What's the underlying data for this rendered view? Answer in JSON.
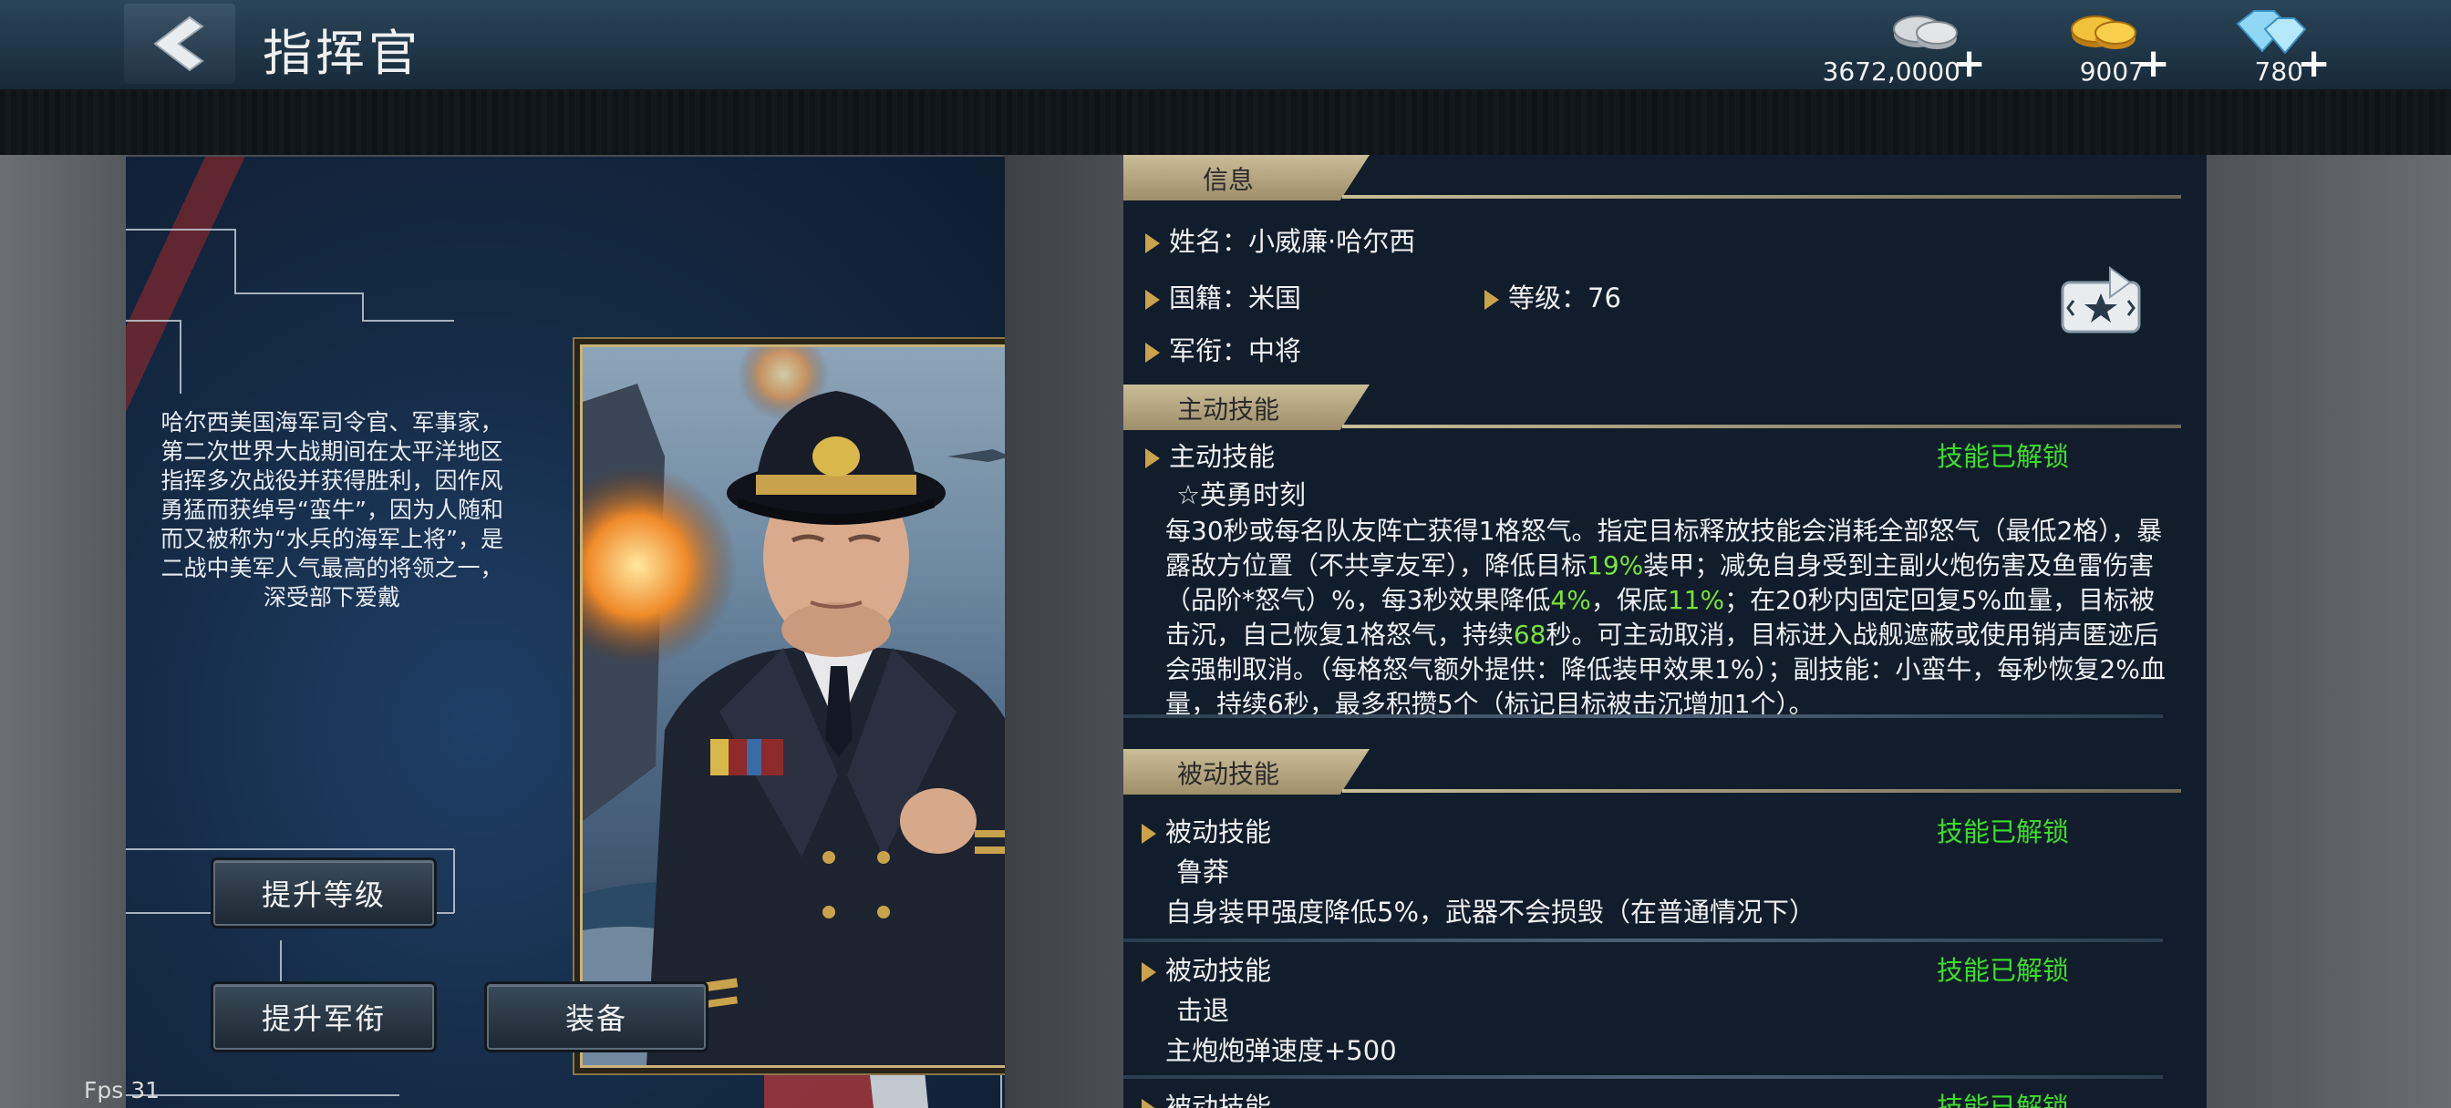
{
  "header": {
    "title": "指挥官",
    "resources": [
      {
        "name": "silver",
        "value": "3672,0000",
        "icon": "silver-coins-icon"
      },
      {
        "name": "gold",
        "value": "9007",
        "icon": "gold-coins-icon"
      },
      {
        "name": "diamond",
        "value": "780",
        "icon": "diamond-icon"
      }
    ]
  },
  "left": {
    "bio": "哈尔西美国海军司令官、军事家，第二次世界大战期间在太平洋地区指挥多次战役并获得胜利，因作风勇猛而获绰号“蛮牛”，因为人随和而又被称为“水兵的海军上将”，是二战中美军人气最高的将领之一，深受部下爱戴",
    "buttons": {
      "upgrade_level": "提升等级",
      "upgrade_rank": "提升军衔",
      "equip": "装备"
    },
    "fps": "Fps 31"
  },
  "info": {
    "section_title": "信息",
    "name_label": "姓名：",
    "name_value": "小威廉·哈尔西",
    "nation_label": "国籍：",
    "nation_value": "米国",
    "level_label": "等级：",
    "level_value": "76",
    "rank_label": "军衔：",
    "rank_value": "中将"
  },
  "active_skill": {
    "section_title": "主动技能",
    "label": "主动技能",
    "status": "技能已解锁",
    "name": "☆英勇时刻",
    "desc_parts": [
      {
        "t": "每30秒或每名队友阵亡获得1格怒气。指定目标释放技能会消耗全部怒气（最低2格），暴露敌方位置（不共享友军），降低目标"
      },
      {
        "t": "19%",
        "hl": true
      },
      {
        "t": "装甲；减免自身受到主副火炮伤害及鱼雷伤害（品阶*怒气）%，每3秒效果降低"
      },
      {
        "t": "4%",
        "hl": true
      },
      {
        "t": "，保底"
      },
      {
        "t": "11%",
        "hl": true
      },
      {
        "t": "；在20秒内固定回复5%血量，目标被击沉，自己恢复1格怒气，持续"
      },
      {
        "t": "68",
        "hl": true
      },
      {
        "t": "秒。可主动取消，目标进入战舰遮蔽或使用销声匿迹后会强制取消。（每格怒气额外提供：降低装甲效果1%）；副技能：小蛮牛，每秒恢复2%血量，持续6秒，最多积攒5个（标记目标被击沉增加1个）。"
      }
    ]
  },
  "passive": {
    "section_title": "被动技能",
    "skills": [
      {
        "label": "被动技能",
        "status": "技能已解锁",
        "name": "鲁莽",
        "desc": "自身装甲强度降低5%，武器不会损毁（在普通情况下）"
      },
      {
        "label": "被动技能",
        "status": "技能已解锁",
        "name": "击退",
        "desc": "主炮炮弹速度+500"
      },
      {
        "label": "被动技能",
        "status": "技能已解锁",
        "name": "",
        "desc": ""
      }
    ]
  },
  "colors": {
    "accent_gold": "#c9a24c",
    "unlock_green": "#3ddc2c",
    "highlight_green": "#78e23c"
  }
}
